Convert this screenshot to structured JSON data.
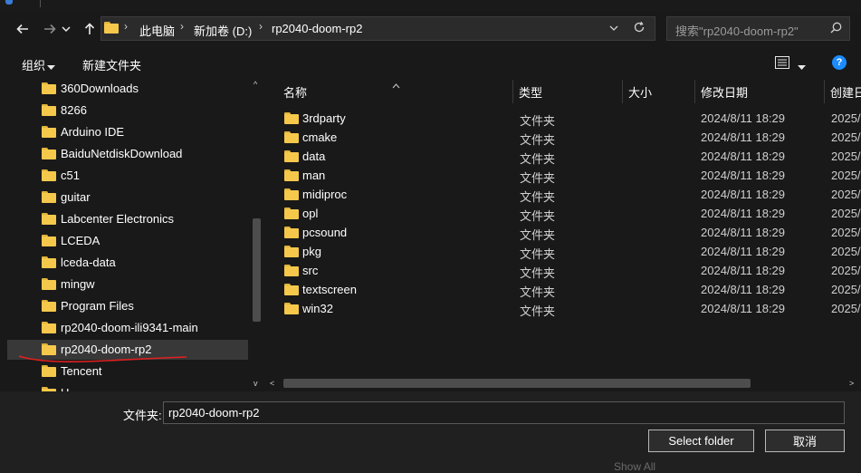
{
  "address_bar": {
    "breadcrumbs": [
      "此电脑",
      "新加卷 (D:)",
      "rp2040-doom-rp2"
    ],
    "search_placeholder": "搜索\"rp2040-doom-rp2\""
  },
  "toolbar": {
    "organize_label": "组织",
    "new_folder_label": "新建文件夹"
  },
  "nav_pane": {
    "items": [
      {
        "label": "360Downloads",
        "selected": false
      },
      {
        "label": "8266",
        "selected": false
      },
      {
        "label": "Arduino IDE",
        "selected": false
      },
      {
        "label": "BaiduNetdiskDownload",
        "selected": false
      },
      {
        "label": "c51",
        "selected": false
      },
      {
        "label": "guitar",
        "selected": false
      },
      {
        "label": "Labcenter Electronics",
        "selected": false
      },
      {
        "label": "LCEDA",
        "selected": false
      },
      {
        "label": "lceda-data",
        "selected": false
      },
      {
        "label": "mingw",
        "selected": false
      },
      {
        "label": "Program Files",
        "selected": false
      },
      {
        "label": "rp2040-doom-ili9341-main",
        "selected": false
      },
      {
        "label": "rp2040-doom-rp2",
        "selected": true
      },
      {
        "label": "Tencent",
        "selected": false
      },
      {
        "label": "U",
        "selected": false
      }
    ]
  },
  "file_list": {
    "columns": {
      "name": "名称",
      "type": "类型",
      "size": "大小",
      "modified": "修改日期",
      "created": "创建日"
    },
    "rows": [
      {
        "name": "3rdparty",
        "type": "文件夹",
        "modified": "2024/8/11 18:29",
        "created": "2025/"
      },
      {
        "name": "cmake",
        "type": "文件夹",
        "modified": "2024/8/11 18:29",
        "created": "2025/"
      },
      {
        "name": "data",
        "type": "文件夹",
        "modified": "2024/8/11 18:29",
        "created": "2025/"
      },
      {
        "name": "man",
        "type": "文件夹",
        "modified": "2024/8/11 18:29",
        "created": "2025/"
      },
      {
        "name": "midiproc",
        "type": "文件夹",
        "modified": "2024/8/11 18:29",
        "created": "2025/"
      },
      {
        "name": "opl",
        "type": "文件夹",
        "modified": "2024/8/11 18:29",
        "created": "2025/"
      },
      {
        "name": "pcsound",
        "type": "文件夹",
        "modified": "2024/8/11 18:29",
        "created": "2025/"
      },
      {
        "name": "pkg",
        "type": "文件夹",
        "modified": "2024/8/11 18:29",
        "created": "2025/"
      },
      {
        "name": "src",
        "type": "文件夹",
        "modified": "2024/8/11 18:29",
        "created": "2025/"
      },
      {
        "name": "textscreen",
        "type": "文件夹",
        "modified": "2024/8/11 18:29",
        "created": "2025/"
      },
      {
        "name": "win32",
        "type": "文件夹",
        "modified": "2024/8/11 18:29",
        "created": "2025/"
      }
    ]
  },
  "footer": {
    "folder_label": "文件夹:",
    "folder_value": "rp2040-doom-rp2",
    "select_button": "Select folder",
    "cancel_button": "取消",
    "background_text": "Show All"
  },
  "colors": {
    "folder_yellow": "#f5c84c",
    "annotation_red": "#e02020",
    "help_blue": "#1a8cff"
  },
  "icons": [
    "back-arrow-icon",
    "forward-arrow-icon",
    "chevron-down-icon",
    "up-arrow-icon",
    "folder-icon",
    "refresh-icon",
    "search-icon",
    "view-menu-icon",
    "help-icon",
    "sort-up-icon"
  ]
}
